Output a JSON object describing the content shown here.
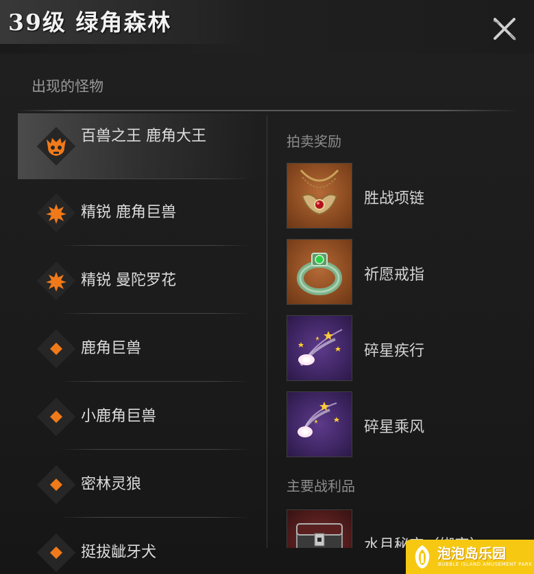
{
  "header": {
    "title": "39级 绿角森林"
  },
  "monsters_section": {
    "title": "出现的怪物",
    "items": [
      {
        "name": "百兽之王 鹿角大王",
        "icon": "boss-skull-icon",
        "tier": "boss"
      },
      {
        "name": "精锐 鹿角巨兽",
        "icon": "elite-burst-icon",
        "tier": "elite"
      },
      {
        "name": "精锐 曼陀罗花",
        "icon": "elite-burst-icon",
        "tier": "elite"
      },
      {
        "name": "鹿角巨兽",
        "icon": "normal-diamond-icon",
        "tier": "normal"
      },
      {
        "name": "小鹿角巨兽",
        "icon": "normal-diamond-icon",
        "tier": "normal"
      },
      {
        "name": "密林灵狼",
        "icon": "normal-diamond-icon",
        "tier": "normal"
      },
      {
        "name": "挺拔龇牙犬",
        "icon": "normal-diamond-icon",
        "tier": "normal"
      }
    ]
  },
  "auction_rewards": {
    "title": "拍卖奖励",
    "items": [
      {
        "name": "胜战项链",
        "icon": "necklace-icon"
      },
      {
        "name": "祈愿戒指",
        "icon": "ring-icon"
      },
      {
        "name": "碎星疾行",
        "icon": "shooting-star-icon"
      },
      {
        "name": "碎星乘风",
        "icon": "shooting-star-icon"
      }
    ]
  },
  "main_loot": {
    "title": "主要战利品",
    "items": [
      {
        "name": "水月秘宝（绑定）",
        "icon": "treasure-chest-icon"
      }
    ]
  },
  "watermark": {
    "name": "泡泡岛乐园",
    "subtitle": "BUBBLE ISLAND AMUSEMENT PARK"
  },
  "colors": {
    "accent_orange": "#f07a1a",
    "background": "#1b1b1b",
    "watermark_yellow": "#f6c812"
  }
}
